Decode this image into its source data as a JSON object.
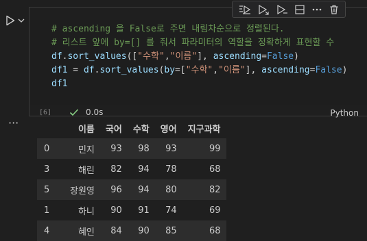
{
  "cell": {
    "code_lines": [
      [
        {
          "t": "# ascending 을 False로 주면 내림차순으로 정렬된다.",
          "c": "c-com"
        }
      ],
      [
        {
          "t": "# 리스트 앞에 by=[] 를 줘서 파라미터의 역할을 정확하게 표현할 수",
          "c": "c-com"
        }
      ],
      [
        {
          "t": "df",
          "c": "c-var"
        },
        {
          "t": ".",
          "c": "c-pl"
        },
        {
          "t": "sort_values",
          "c": "c-var"
        },
        {
          "t": "([",
          "c": "c-pl"
        },
        {
          "t": "\"수학\"",
          "c": "c-str"
        },
        {
          "t": ",",
          "c": "c-pl"
        },
        {
          "t": "\"이름\"",
          "c": "c-str"
        },
        {
          "t": "], ",
          "c": "c-pl"
        },
        {
          "t": "ascending",
          "c": "c-var"
        },
        {
          "t": "=",
          "c": "c-pl"
        },
        {
          "t": "False",
          "c": "c-kw"
        },
        {
          "t": ")",
          "c": "c-pl"
        }
      ],
      [
        {
          "t": "df1",
          "c": "c-var"
        },
        {
          "t": " = ",
          "c": "c-pl"
        },
        {
          "t": "df",
          "c": "c-var"
        },
        {
          "t": ".",
          "c": "c-pl"
        },
        {
          "t": "sort_values",
          "c": "c-var"
        },
        {
          "t": "(",
          "c": "c-pl"
        },
        {
          "t": "by",
          "c": "c-var"
        },
        {
          "t": "=[",
          "c": "c-pl"
        },
        {
          "t": "\"수학\"",
          "c": "c-str"
        },
        {
          "t": ",",
          "c": "c-pl"
        },
        {
          "t": "\"이름\"",
          "c": "c-str"
        },
        {
          "t": "], ",
          "c": "c-pl"
        },
        {
          "t": "ascending",
          "c": "c-var"
        },
        {
          "t": "=",
          "c": "c-pl"
        },
        {
          "t": "False",
          "c": "c-kw"
        },
        {
          "t": ")",
          "c": "c-pl"
        }
      ],
      [
        {
          "t": "df1",
          "c": "c-var"
        }
      ]
    ],
    "execution_count": "[6]",
    "duration": "0.0s",
    "language": "Python",
    "status_color": "#89d185"
  },
  "toolbar": {
    "icons": [
      "execute-above-icon",
      "execute-cell-below-icon",
      "execute-below-icon",
      "split-cell-icon",
      "more-actions-icon",
      "delete-icon"
    ]
  },
  "output": {
    "menu": "···",
    "columns": [
      "",
      "이름",
      "국어",
      "수학",
      "영어",
      "지구과학"
    ],
    "rows": [
      [
        "0",
        "민지",
        "93",
        "98",
        "93",
        "99"
      ],
      [
        "3",
        "해린",
        "82",
        "94",
        "78",
        "68"
      ],
      [
        "5",
        "장원영",
        "96",
        "94",
        "80",
        "82"
      ],
      [
        "1",
        "하니",
        "90",
        "91",
        "74",
        "69"
      ],
      [
        "4",
        "혜인",
        "84",
        "90",
        "85",
        "68"
      ]
    ]
  }
}
